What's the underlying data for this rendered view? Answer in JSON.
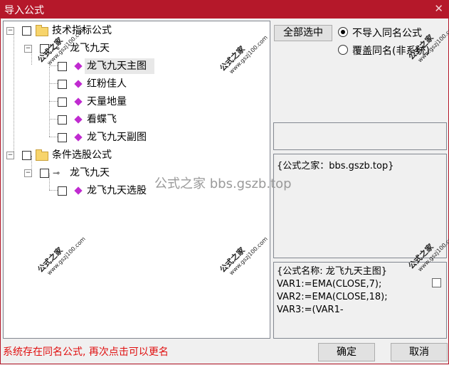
{
  "window": {
    "title": "导入公式",
    "close_glyph": "✕"
  },
  "tree": {
    "nodes": [
      {
        "label": "技术指标公式",
        "type": "folder"
      },
      {
        "label": "龙飞九天",
        "type": "key"
      },
      {
        "label": "龙飞九天主图",
        "type": "gem"
      },
      {
        "label": "红粉佳人",
        "type": "gem"
      },
      {
        "label": "天量地量",
        "type": "gem"
      },
      {
        "label": "看蝶飞",
        "type": "gem"
      },
      {
        "label": "龙飞九天副图",
        "type": "gem"
      },
      {
        "label": "条件选股公式",
        "type": "folder"
      },
      {
        "label": "龙飞九天",
        "type": "key"
      },
      {
        "label": "龙飞九天选股",
        "type": "gem"
      }
    ]
  },
  "controls": {
    "select_all": "全部选中",
    "radio_no_import": "不导入同名公式",
    "radio_overwrite": "覆盖同名(非系统)",
    "radio_selected": "no_import"
  },
  "info_box": {
    "text": "{公式之家：bbs.gszb.top}"
  },
  "formula_box": {
    "lines": [
      "{公式名称: 龙飞九天主图}",
      "VAR1:=EMA(CLOSE,7);",
      "VAR2:=EMA(CLOSE,18);",
      "VAR3:=(VAR1-"
    ]
  },
  "footer": {
    "status": "系统存在同名公式, 再次点击可以更名",
    "ok": "确定",
    "cancel": "取消"
  },
  "watermarks": {
    "main": "公式之家",
    "sub": "www.gszj100.com",
    "center": "公式之家 bbs.gszb.top"
  },
  "colors": {
    "titlebar": "#b5182a",
    "status_text": "#e01010",
    "gem": "#c02bd0"
  }
}
